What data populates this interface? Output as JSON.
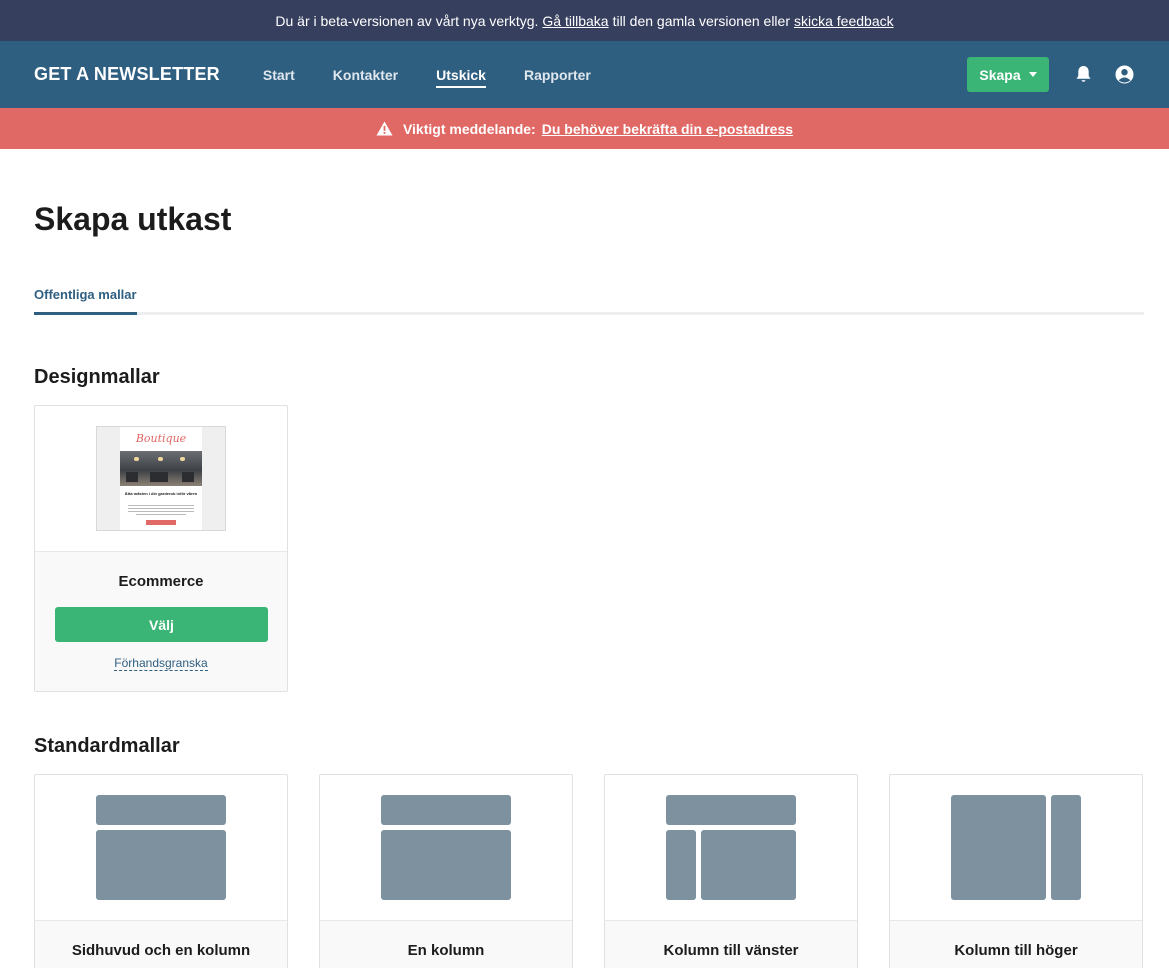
{
  "beta_bar": {
    "text_before": "Du är i beta-versionen av vårt nya verktyg.",
    "back_link": "Gå tillbaka",
    "text_middle": "till den gamla versionen eller",
    "feedback_link": "skicka feedback"
  },
  "nav": {
    "brand": "GET A NEWSLETTER",
    "items": [
      {
        "label": "Start",
        "active": false
      },
      {
        "label": "Kontakter",
        "active": false
      },
      {
        "label": "Utskick",
        "active": true
      },
      {
        "label": "Rapporter",
        "active": false
      }
    ],
    "create_button": "Skapa",
    "bell_icon": "bell-icon",
    "user_icon": "user-circle-icon"
  },
  "alert": {
    "icon": "warning-icon",
    "label": "Viktigt meddelande:",
    "link": "Du behöver bekräfta din e-postadress"
  },
  "page": {
    "title": "Skapa utkast",
    "tabs": [
      {
        "label": "Offentliga mallar",
        "active": true
      }
    ]
  },
  "design_templates": {
    "title": "Designmallar",
    "cards": [
      {
        "name": "Ecommerce",
        "choose_label": "Välj",
        "preview_label": "Förhandsgranska",
        "thumb": {
          "logo": "Boutique",
          "heading": "Ätta måsten i din garderob inför våren"
        }
      }
    ]
  },
  "standard_templates": {
    "title": "Standardmallar",
    "cards": [
      {
        "name": "Sidhuvud och en kolumn",
        "layout": "header-one-column"
      },
      {
        "name": "En kolumn",
        "layout": "one-column"
      },
      {
        "name": "Kolumn till vänster",
        "layout": "left-column"
      },
      {
        "name": "Kolumn till höger",
        "layout": "right-column"
      }
    ]
  },
  "colors": {
    "beta_bar": "#373f5e",
    "nav": "#2f5f80",
    "alert": "#e06865",
    "primary_button": "#3bb575",
    "layout_block": "#7d919f"
  }
}
